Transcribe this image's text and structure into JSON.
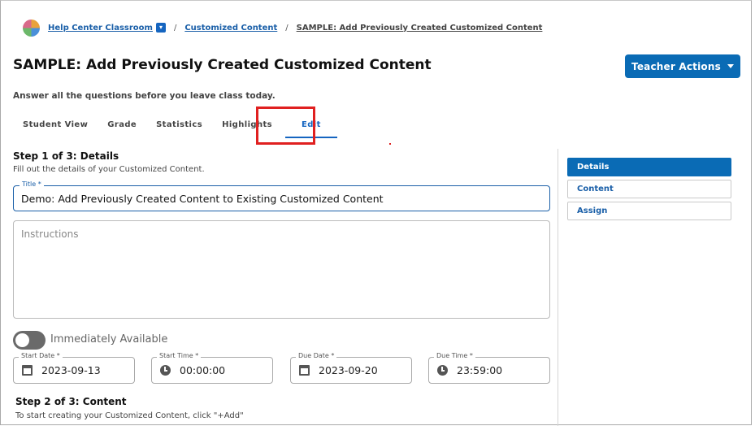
{
  "breadcrumb": {
    "class_name": "Help Center Classroom",
    "section": "Customized Content",
    "current": "SAMPLE: Add Previously Created Customized Content",
    "separator": "/"
  },
  "page": {
    "title": "SAMPLE: Add Previously Created Customized Content",
    "subtitle": "Answer all the questions before you leave class today."
  },
  "teacher_actions": {
    "label": "Teacher Actions"
  },
  "tabs": [
    {
      "label": "Student View"
    },
    {
      "label": "Grade"
    },
    {
      "label": "Statistics"
    },
    {
      "label": "Highlights"
    },
    {
      "label": "Edit",
      "active": true
    }
  ],
  "step1": {
    "heading": "Step 1 of 3: Details",
    "description": "Fill out the details of your Customized Content."
  },
  "form": {
    "title_label": "Title *",
    "title_value": "Demo: Add Previously Created Content to Existing Customized Content",
    "instructions_placeholder": "Instructions",
    "immediately_available_label": "Immediately Available",
    "immediately_available": false,
    "start_date_label": "Start Date *",
    "start_date": "2023-09-13",
    "start_time_label": "Start Time *",
    "start_time": "00:00:00",
    "due_date_label": "Due Date *",
    "due_date": "2023-09-20",
    "due_time_label": "Due Time *",
    "due_time": "23:59:00"
  },
  "step2": {
    "heading": "Step 2 of 3: Content",
    "description": "To start creating your Customized Content, click \"+Add\""
  },
  "side_nav": [
    {
      "label": "Details",
      "active": true
    },
    {
      "label": "Content"
    },
    {
      "label": "Assign"
    }
  ],
  "colors": {
    "primary": "#0a6bb5",
    "link": "#1a5fa8",
    "highlight": "#e02020"
  },
  "icons": [
    "class-logo-icon",
    "chevron-down-icon",
    "caret-down-icon",
    "calendar-icon",
    "clock-icon"
  ]
}
